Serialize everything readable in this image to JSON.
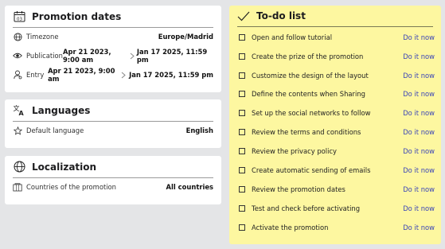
{
  "promotion_dates": {
    "title": "Promotion dates",
    "timezone_label": "Timezone",
    "timezone_value": "Europe/Madrid",
    "publication_label": "Publication",
    "publication_from": "Apr 21 2023, 9:00 am",
    "publication_to": "Jan 17 2025, 11:59 pm",
    "entry_label": "Entry",
    "entry_from": "Apr 21 2023, 9:00 am",
    "entry_to": "Jan 17 2025, 11:59 pm",
    "calendar_day": "03"
  },
  "languages": {
    "title": "Languages",
    "default_label": "Default language",
    "default_value": "English"
  },
  "localization": {
    "title": "Localization",
    "countries_label": "Countries of the promotion",
    "countries_value": "All countries"
  },
  "todo": {
    "title": "To-do list",
    "action_label": "Do it now",
    "items": [
      "Open and follow tutorial",
      "Create the prize of the promotion",
      "Customize the design of the layout",
      "Define the contents when Sharing",
      "Set up the social networks to follow",
      "Review the terms and conditions",
      "Review the privacy policy",
      "Create automatic sending of emails",
      "Review the promotion dates",
      "Test and check before activating",
      "Activate the promotion"
    ]
  },
  "colors": {
    "background": "#e4e5e7",
    "card": "#ffffff",
    "todo_background": "#fdf7a0",
    "link": "#3a44b8"
  }
}
